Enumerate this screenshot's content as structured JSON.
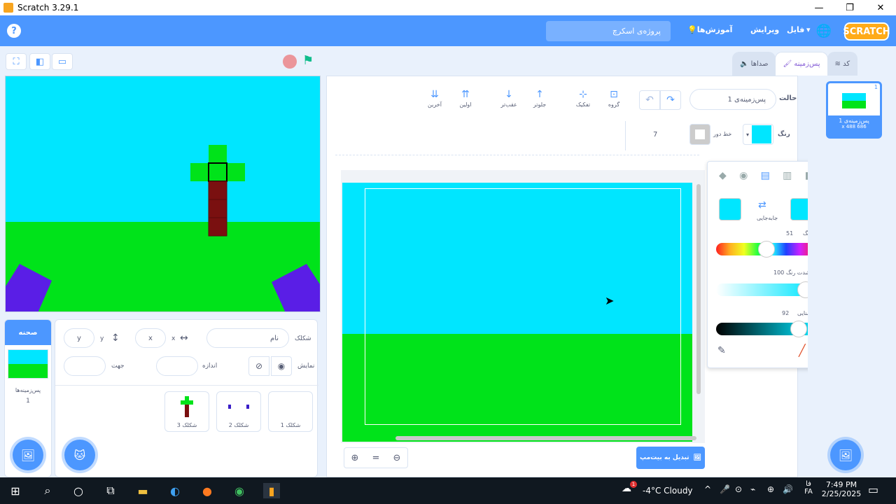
{
  "window": {
    "title": "Scratch 3.29.1",
    "min": "—",
    "max": "❐",
    "close": "✕"
  },
  "menubar": {
    "help": "?",
    "logo": "SCRATCH",
    "globe": "🌐",
    "file": "فایل",
    "edit": "ویرایش",
    "tutorials": "آموزش‌ها",
    "project_title": "پروژه‌ی اسکرچ"
  },
  "tabs": {
    "code": "کد",
    "backdrops": "پس‌زمینه",
    "sounds": "صداها"
  },
  "editor": {
    "costume_label": "حالت",
    "costume_name": "پس‌زمینه‌ی 1",
    "tools": [
      "گروه",
      "تفکیک",
      "جلوتر",
      "عقب‌تر",
      "اولین",
      "آخرین"
    ],
    "fill_label": "رنگ",
    "outline_label": "خط دور",
    "outline_value": "7",
    "convert_button": "تبدیل به بیت‌مپ",
    "fill_color": "#00e6ff"
  },
  "picker": {
    "color_label": "رنگ",
    "color_value": "51",
    "saturation_label": "شدت رنگ",
    "saturation_value": "100",
    "brightness_label": "روشنایی",
    "brightness_value": "92",
    "swap_label": "جابه‌جایی"
  },
  "sprite_info": {
    "sprite_label": "شکلک",
    "name_placeholder": "نام",
    "x_label": "x",
    "x_value": "x",
    "y_label": "y",
    "y_value": "y",
    "show_label": "نمایش",
    "size_label": "اندازه",
    "direction_label": "جهت"
  },
  "sprites": [
    {
      "name": "شکلک 1"
    },
    {
      "name": "شکلک 2"
    },
    {
      "name": "شکلک 3"
    }
  ],
  "stage_pane": {
    "header": "صحنه",
    "backdrops_label": "پس‌زمینه‌ها",
    "backdrops_count": "1"
  },
  "costume_list": [
    {
      "index": "1",
      "name": "پس‌زمینه‌ی 1",
      "size": "x 488 686"
    }
  ],
  "taskbar": {
    "weather": "-4°C  Cloudy",
    "lang_top": "فا",
    "lang": "FA",
    "time": "7:49 PM",
    "date": "2/25/2025",
    "notification_count": "1"
  },
  "colors": {
    "accent": "#4c97ff",
    "sky": "#00e6ff",
    "ground": "#00e31a",
    "purple": "#5a1ee6",
    "dark_red": "#7a1010"
  }
}
